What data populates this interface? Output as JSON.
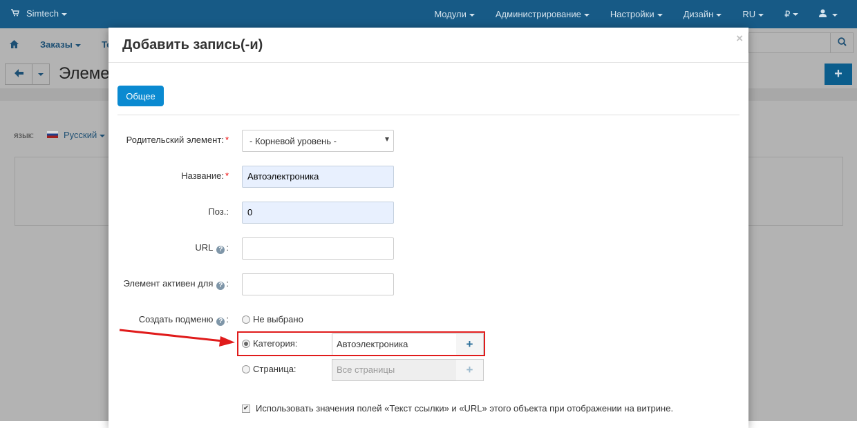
{
  "topbar": {
    "brand": "Simtech",
    "nav": [
      "Модули",
      "Администрирование",
      "Настройки",
      "Дизайн",
      "RU",
      "₽"
    ],
    "user_icon": "user-icon"
  },
  "subbar": {
    "home_icon": "home-icon",
    "orders": "Заказы",
    "truncated": "Те",
    "search_icon": "search-icon"
  },
  "titlebar": {
    "title": "Элеме",
    "back_icon": "arrow-left-icon",
    "add_icon": "plus-icon"
  },
  "language": {
    "label": "язык:",
    "value": "Русский"
  },
  "modal": {
    "title": "Добавить запись(-и)",
    "close": "×",
    "tab": "Общее",
    "fields": {
      "parent": {
        "label": "Родительский элемент:",
        "value": "- Корневой уровень -"
      },
      "name": {
        "label": "Название:",
        "value": "Автоэлектроника"
      },
      "position": {
        "label": "Поз.:",
        "value": "0"
      },
      "url": {
        "label": "URL",
        "value": ""
      },
      "active_for": {
        "label": "Элемент активен для",
        "value": ""
      }
    },
    "submenu": {
      "label": "Создать подменю",
      "options": {
        "none": "Не выбрано",
        "category": "Категория:",
        "page": "Страница:"
      },
      "category_value": "Автоэлектроника",
      "page_placeholder": "Все страницы"
    },
    "checkbox_label": "Использовать значения полей «Текст ссылки» и «URL» этого объекта при отображении на витрине."
  },
  "colors": {
    "topbar": "#175a86",
    "primary_button": "#0a8ad1",
    "annotation": "#e01b1b"
  }
}
